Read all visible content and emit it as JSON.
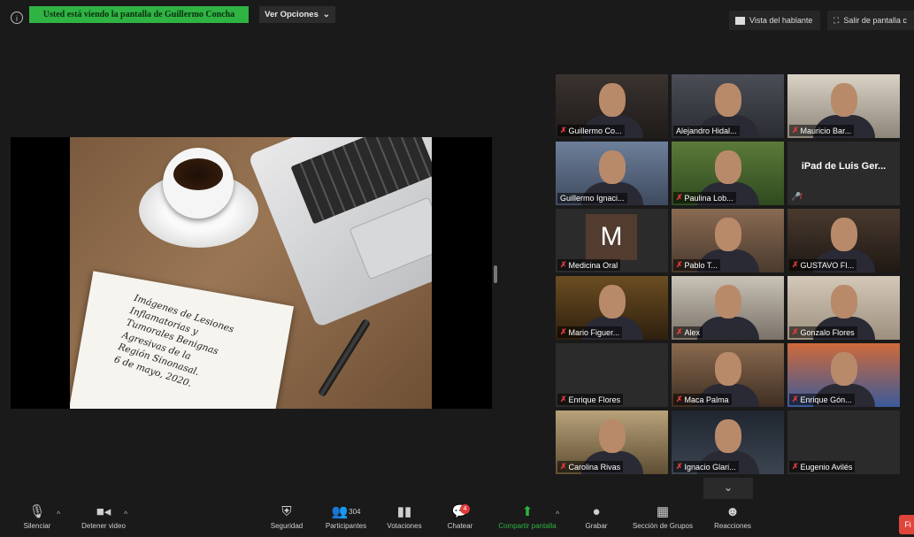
{
  "top": {
    "banner": "Usted está viendo la pantalla de Guillermo Concha",
    "view_options": "Ver Opciones",
    "view_options_caret": "⌄",
    "speaker_view": "Vista del hablante",
    "exit_fullscreen": "Salir de pantalla c"
  },
  "slide": {
    "text": "Imágenes de Lesiones\nInflamatorias y\nTumorales Benignas\nAgresivas de la\nRegión Sinonasal.\n6 de mayo, 2020."
  },
  "participants": [
    {
      "name": "Guillermo Co...",
      "muted": true
    },
    {
      "name": "Alejandro Hidal...",
      "muted": false
    },
    {
      "name": "Mauricio Bar...",
      "muted": true
    },
    {
      "name": "Guillermo Ignaci...",
      "muted": false,
      "active": true
    },
    {
      "name": "Paulina Lob...",
      "muted": true
    },
    {
      "name": "iPad de Luis Ger...",
      "muted": true
    },
    {
      "name": "Medicina Oral",
      "muted": true,
      "letter": "M"
    },
    {
      "name": "Pablo T...",
      "muted": true
    },
    {
      "name": "GUSTAVO FI...",
      "muted": true
    },
    {
      "name": "Mario Figuer...",
      "muted": true
    },
    {
      "name": "Alex",
      "muted": true
    },
    {
      "name": "Gonzalo Flores",
      "muted": true
    },
    {
      "name": "Enrique Flores",
      "muted": true
    },
    {
      "name": "Maca Palma",
      "muted": true
    },
    {
      "name": "Enrique Gón...",
      "muted": true
    },
    {
      "name": "Carolina Rivas",
      "muted": true
    },
    {
      "name": "Ignacio Glari...",
      "muted": true
    },
    {
      "name": "Eugenio Avilés",
      "muted": true
    }
  ],
  "toolbar": {
    "mute": "Silenciar",
    "stop_video": "Detener video",
    "security": "Seguridad",
    "participants": "Participantes",
    "participants_count": "304",
    "polls": "Votaciones",
    "chat": "Chatear",
    "chat_badge": "4",
    "share_screen": "Compartir pantalla",
    "record": "Grabar",
    "breakout_rooms": "Sección de Grupos",
    "reactions": "Reacciones",
    "end": "Fi"
  },
  "colors": {
    "accent_green": "#2fb343",
    "active_border": "#d6e05a",
    "muted_red": "#e23b3b"
  }
}
